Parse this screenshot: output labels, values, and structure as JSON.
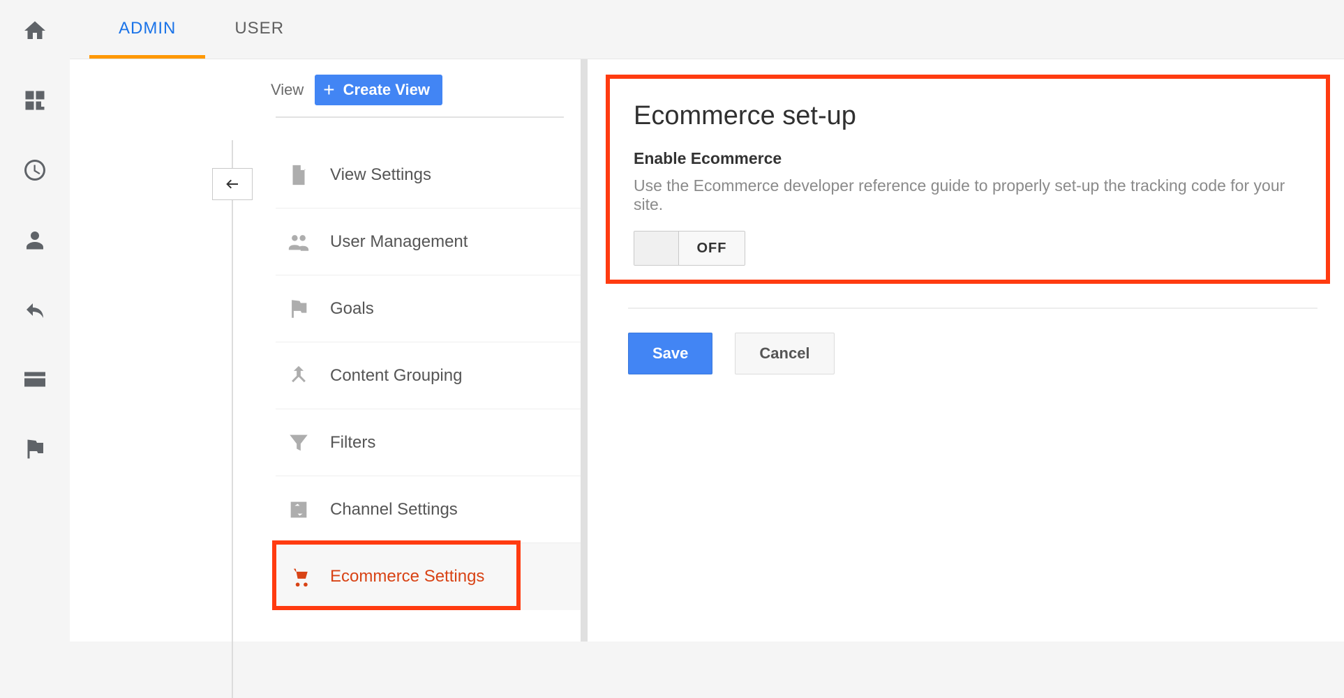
{
  "tabs": {
    "admin": "ADMIN",
    "user": "USER"
  },
  "view": {
    "header_label": "View",
    "create_label": "Create View",
    "items": [
      {
        "label": "View Settings"
      },
      {
        "label": "User Management"
      },
      {
        "label": "Goals"
      },
      {
        "label": "Content Grouping"
      },
      {
        "label": "Filters"
      },
      {
        "label": "Channel Settings"
      },
      {
        "label": "Ecommerce Settings"
      }
    ]
  },
  "ecommerce": {
    "title": "Ecommerce set-up",
    "subheading": "Enable Ecommerce",
    "description": "Use the Ecommerce developer reference guide to properly set-up the tracking code for your site.",
    "toggle_state": "OFF"
  },
  "actions": {
    "save": "Save",
    "cancel": "Cancel"
  }
}
